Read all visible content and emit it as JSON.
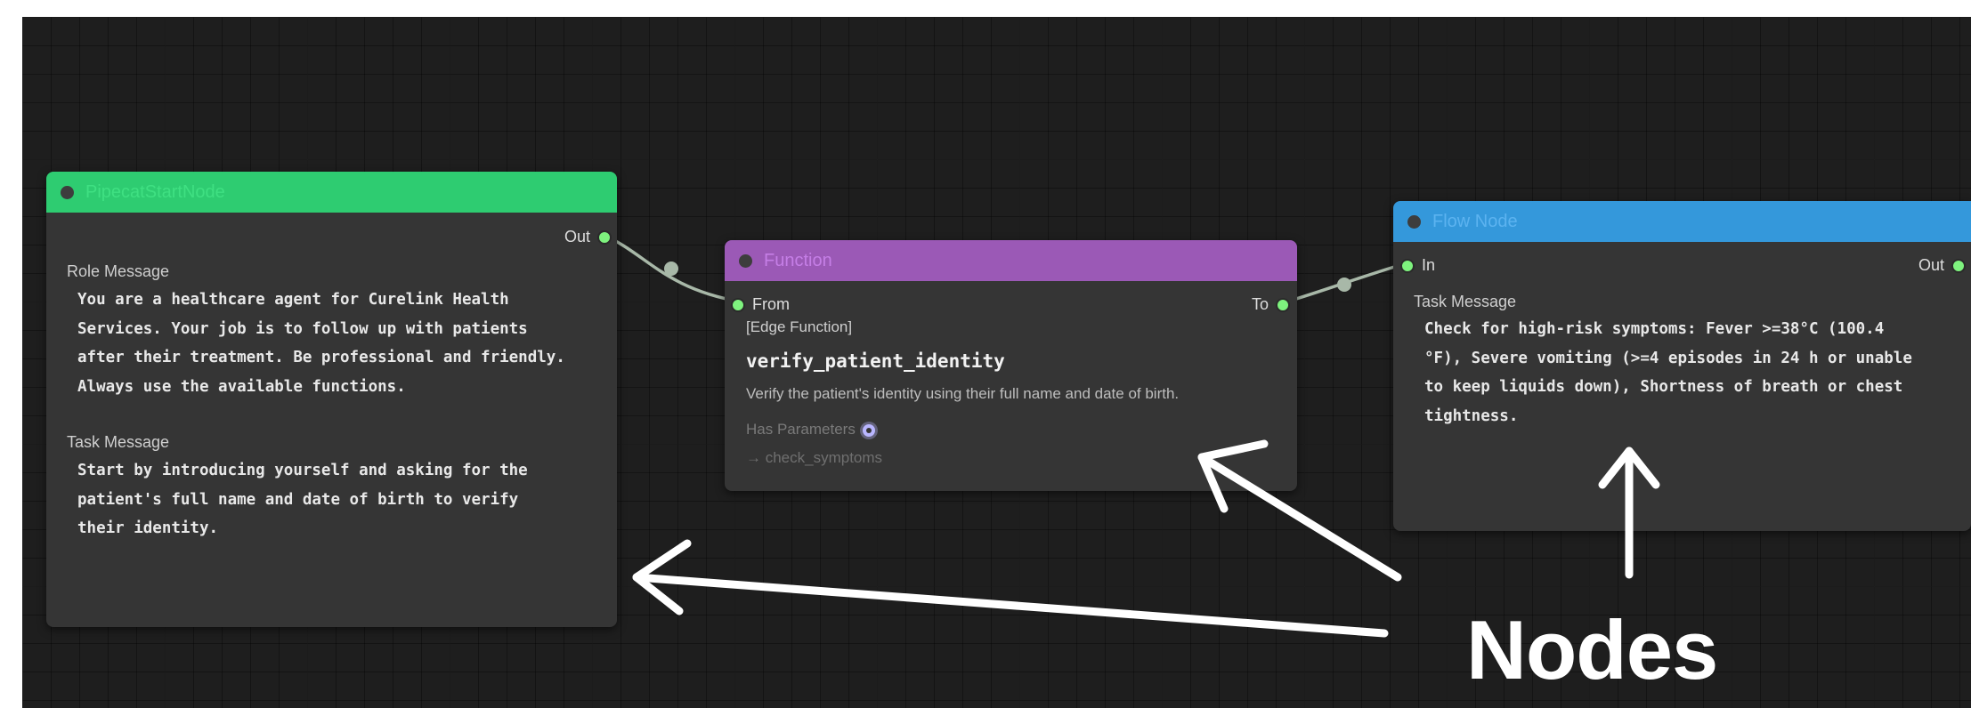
{
  "colors": {
    "start_header": "#2ecc71",
    "function_header": "#9b59b6",
    "flow_header": "#3498db",
    "port": "#7ef27e",
    "edge": "#a8b8a8"
  },
  "start_node": {
    "title": "PipecatStartNode",
    "out_port": "Out",
    "role_label": "Role Message",
    "role_text": "You are a healthcare agent for Curelink Health\nServices. Your job is to follow up with patients\nafter their treatment. Be professional and friendly.\nAlways use the available functions.",
    "task_label": "Task Message",
    "task_text": "Start by introducing yourself and asking for the\npatient's full name and date of birth to verify\ntheir identity."
  },
  "function_node": {
    "title": "Function",
    "from_port": "From",
    "to_port": "To",
    "type_label": "[Edge Function]",
    "name": "verify_patient_identity",
    "description": "Verify the patient's identity using their full name and date of birth.",
    "params_label": "Has Parameters",
    "params_icon": "gear-icon",
    "transition": "→ check_symptoms"
  },
  "flow_node": {
    "title": "Flow Node",
    "in_port": "In",
    "out_port": "Out",
    "task_label": "Task Message",
    "task_text": "Check for high-risk symptoms: Fever >=38°C (100.4\n°F), Severe vomiting (>=4 episodes in 24 h or unable\nto keep liquids down), Shortness of breath or chest\ntightness."
  },
  "annotation": {
    "label": "Nodes"
  }
}
